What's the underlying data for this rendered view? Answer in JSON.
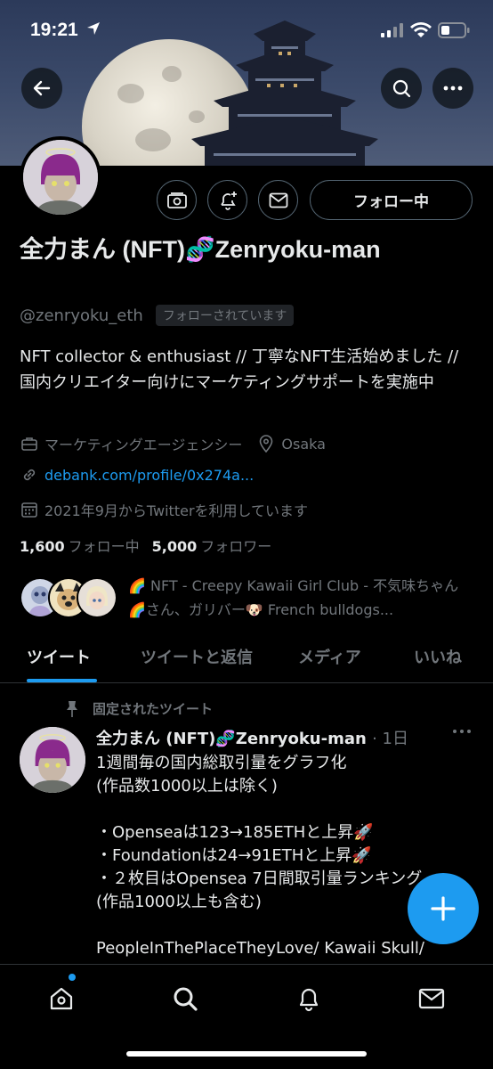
{
  "status_bar": {
    "time": "19:21"
  },
  "profile": {
    "name": "全力まん (NFT)🧬Zenryoku-man",
    "handle": "@zenryoku_eth",
    "follows_you": "フォローされています",
    "follow_button": "フォロー中",
    "bio": "NFT collector & enthusiast // 丁寧なNFT生活始めました // 国内クリエイター向けにマーケティングサポートを実施中",
    "category": "マーケティングエージェンシー",
    "location": "Osaka",
    "link": "debank.com/profile/0x274a...",
    "joined": "2021年9月からTwitterを利用しています",
    "following_count": "1,600",
    "following_label": "フォロー中",
    "followers_count": "5,000",
    "followers_label": "フォロワー",
    "followed_by": "🌈 NFT - Creepy Kawaii Girl Club - 不気味ちゃん 🌈さん、ガリバー🐶 French bulldogs..."
  },
  "tabs": [
    {
      "label": "ツイート"
    },
    {
      "label": "ツイートと返信"
    },
    {
      "label": "メディア"
    },
    {
      "label": "いいね"
    }
  ],
  "pinned_tweet": {
    "pinned_label": "固定されたツイート",
    "author": "全力まん (NFT)🧬Zenryoku-man",
    "date": "· 1日",
    "body": "1週間毎の国内総取引量をグラフ化\n(作品数1000以上は除く)\n\n・Openseaは123→185ETHと上昇🚀\n・Foundationは24→91ETHと上昇🚀\n・２枚目はOpensea 7日間取引量ランキング\n(作品1000以上も含む)\n\nPeopleInThePlaceTheyLove/ Kawaii Skull/"
  },
  "icons": {
    "back": "back-arrow-icon",
    "search": "search-icon",
    "more": "more-icon",
    "fab": "compose-plus-icon"
  },
  "colors": {
    "accent": "#1d9bf0",
    "background": "#000000",
    "muted": "#71767b"
  }
}
